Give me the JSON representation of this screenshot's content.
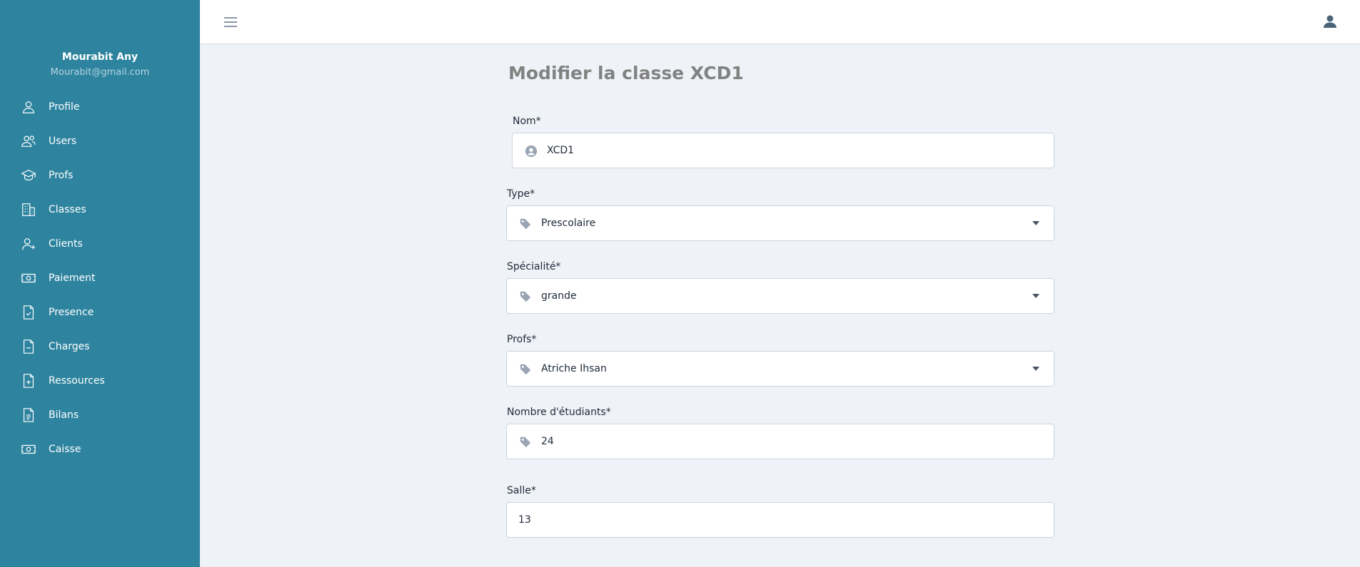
{
  "sidebar": {
    "user_name": "Mourabit Any",
    "user_email": "Mourabit@gmail.com",
    "items": [
      {
        "label": "Profile",
        "icon": "user-icon"
      },
      {
        "label": "Users",
        "icon": "users-icon"
      },
      {
        "label": "Profs",
        "icon": "graduation-cap-icon"
      },
      {
        "label": "Classes",
        "icon": "building-icon"
      },
      {
        "label": "Clients",
        "icon": "user-plus-icon"
      },
      {
        "label": "Paiement",
        "icon": "money-icon"
      },
      {
        "label": "Presence",
        "icon": "file-check-icon"
      },
      {
        "label": "Charges",
        "icon": "file-minus-icon"
      },
      {
        "label": "Ressources",
        "icon": "file-plus-icon"
      },
      {
        "label": "Bilans",
        "icon": "file-text-icon"
      },
      {
        "label": "Caisse",
        "icon": "money-icon"
      }
    ]
  },
  "topbar": {
    "menu_icon": "hamburger-icon",
    "account_icon": "account-icon"
  },
  "page": {
    "title": "Modifier la classe XCD1"
  },
  "form": {
    "nom": {
      "label": "Nom*",
      "value": "XCD1"
    },
    "type": {
      "label": "Type*",
      "value": "Prescolaire"
    },
    "specialite": {
      "label": "Spécialité*",
      "value": "grande"
    },
    "profs": {
      "label": "Profs*",
      "value": "Atriche Ihsan"
    },
    "nombre": {
      "label": "Nombre d'étudiants*",
      "value": "24"
    },
    "salle": {
      "label": "Salle*",
      "value": "13"
    }
  },
  "colors": {
    "sidebar": "#2e849f",
    "background": "#eff3f8",
    "title": "#828282"
  }
}
